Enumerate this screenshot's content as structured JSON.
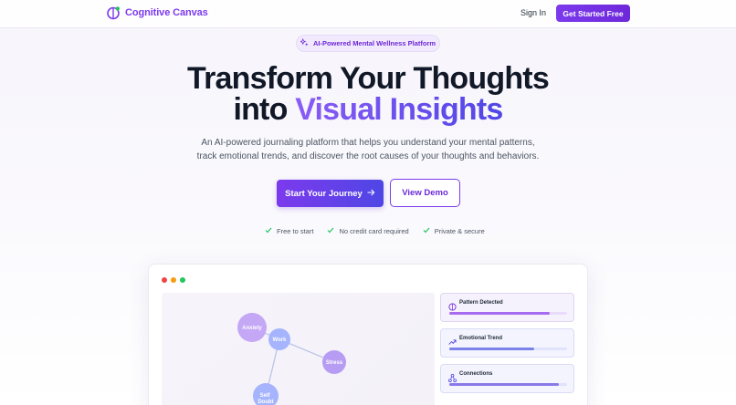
{
  "nav": {
    "brand": "Cognitive Canvas",
    "signin_label": "Sign In",
    "cta_label": "Get Started Free"
  },
  "badge": {
    "label": "AI-Powered Mental Wellness Platform",
    "icon": "sparkle-icon"
  },
  "hero": {
    "title_line1": "Transform Your Thoughts",
    "title_line2_plain": "into ",
    "title_line2_highlight": "Visual Insights",
    "subtitle_line1": "An AI-powered journaling platform that helps you understand your mental patterns,",
    "subtitle_line2": "track emotional trends, and discover the root causes of your thoughts and behaviors.",
    "primary_button": "Start Your Journey",
    "secondary_button": "View Demo",
    "features": [
      "Free to start",
      "No credit card required",
      "Private & secure"
    ]
  },
  "preview": {
    "graph_nodes": [
      {
        "label": "Anxiety",
        "color": "#c4a7f5"
      },
      {
        "label": "Work",
        "color": "#a5b4fc"
      },
      {
        "label": "Stress",
        "color": "#b79cf3"
      },
      {
        "label": "Self\nDoubt",
        "color": "#a5b4fc"
      }
    ],
    "insights": [
      {
        "title": "Pattern Detected",
        "icon": "brain-icon",
        "progress": 0.85,
        "track": "#e9dcfb",
        "fill": "#a76bf0"
      },
      {
        "title": "Emotional Trend",
        "icon": "trend-icon",
        "progress": 0.72,
        "track": "#dfe3fb",
        "fill": "#7b83ea"
      },
      {
        "title": "Connections",
        "icon": "network-icon",
        "progress": 0.93,
        "track": "#dfe3fb",
        "fill": "#8b78e8"
      }
    ]
  },
  "colors": {
    "accent": "#7c3aed",
    "accent_dark": "#4f46e5",
    "check": "#22c55e",
    "window_red": "#ef4444",
    "window_yellow": "#f59e0b",
    "window_green": "#22c55e"
  }
}
